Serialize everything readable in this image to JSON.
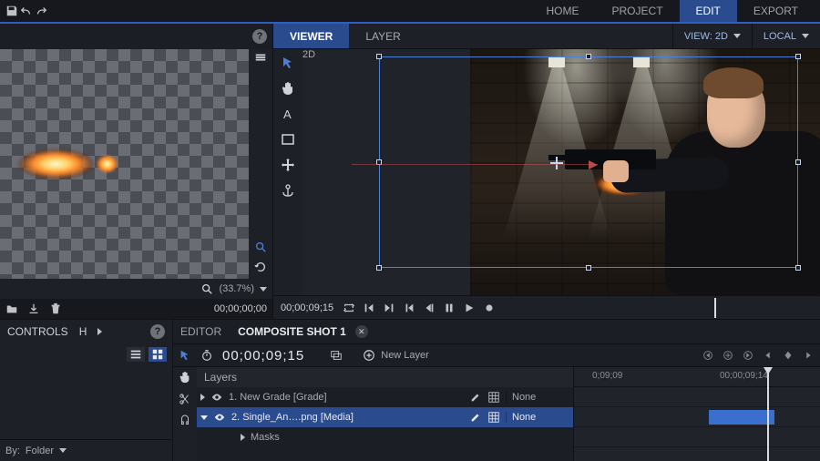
{
  "nav": {
    "home": "HOME",
    "project": "PROJECT",
    "edit": "EDIT",
    "export": "EXPORT"
  },
  "leftPanel": {
    "zoom": "(33.7%)",
    "timecode": "00;00;00;00"
  },
  "viewer": {
    "tabs": {
      "viewer": "VIEWER",
      "layer": "LAYER"
    },
    "viewLabel": "VIEW: 2D",
    "local": "LOCAL",
    "badge": "2D",
    "playTime": "00;00;09;15"
  },
  "bottomLeft": {
    "tabs": {
      "controls": "CONTROLS",
      "h": "H"
    },
    "byLabel": "By:",
    "byValue": "Folder"
  },
  "editor": {
    "tabs": {
      "editor": "EDITOR",
      "comp": "COMPOSITE SHOT 1"
    },
    "timecode": "00;00;09;15",
    "newLayer": "New Layer",
    "layersHeader": "Layers",
    "layer1": "1. New Grade [Grade]",
    "layer2": "2. Single_An….png [Media]",
    "blend": "None",
    "masks": "Masks",
    "tick1": "0;09;09",
    "tick2": "00;00;09;14"
  }
}
